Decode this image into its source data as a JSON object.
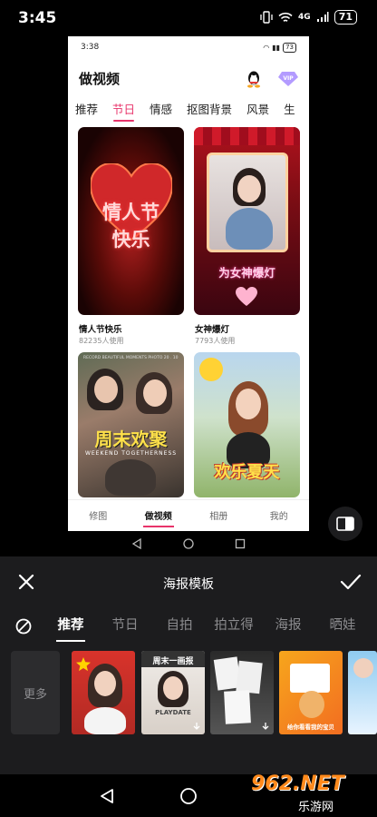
{
  "status_bar": {
    "time": "3:45",
    "network": "4G",
    "battery": "71"
  },
  "preview": {
    "status": {
      "time": "3:38",
      "battery": "73"
    },
    "app_title": "做视频",
    "category_tabs": [
      "推荐",
      "节日",
      "情感",
      "抠图背景",
      "风景",
      "生"
    ],
    "active_category": "节日",
    "cards": [
      {
        "name": "情人节快乐",
        "uses": "82235人使用",
        "overlay_lines": [
          "情人节",
          "快乐"
        ]
      },
      {
        "name": "女神爆灯",
        "uses": "7793人使用",
        "overlay": "为女神爆灯"
      },
      {
        "name": "",
        "uses": "",
        "overlay": "周末欢聚",
        "overlay_sub": "WEEKEND TOGETHERNESS",
        "overlay_top": "RECORD BEAUTIFUL MOMENTS   PHOTO 20 . 10"
      },
      {
        "name": "",
        "uses": "",
        "overlay": "欢乐夏天"
      }
    ],
    "bottom_nav": [
      "修图",
      "做视频",
      "相册",
      "我的"
    ],
    "active_bottom_nav": "做视频"
  },
  "panel": {
    "title": "海报模板",
    "tabs": [
      "推荐",
      "节日",
      "自拍",
      "拍立得",
      "海报",
      "晒娃"
    ],
    "active_tab": "推荐",
    "more_label": "更多",
    "thumb_texts": [
      "周末一画报",
      "PLAYDATE",
      "给你看看我的宝贝"
    ]
  },
  "watermark": {
    "text": "962.NET",
    "sub": "乐游网"
  },
  "colors": {
    "accent": "#e8336a",
    "panel_bg": "#1c1c1e"
  }
}
